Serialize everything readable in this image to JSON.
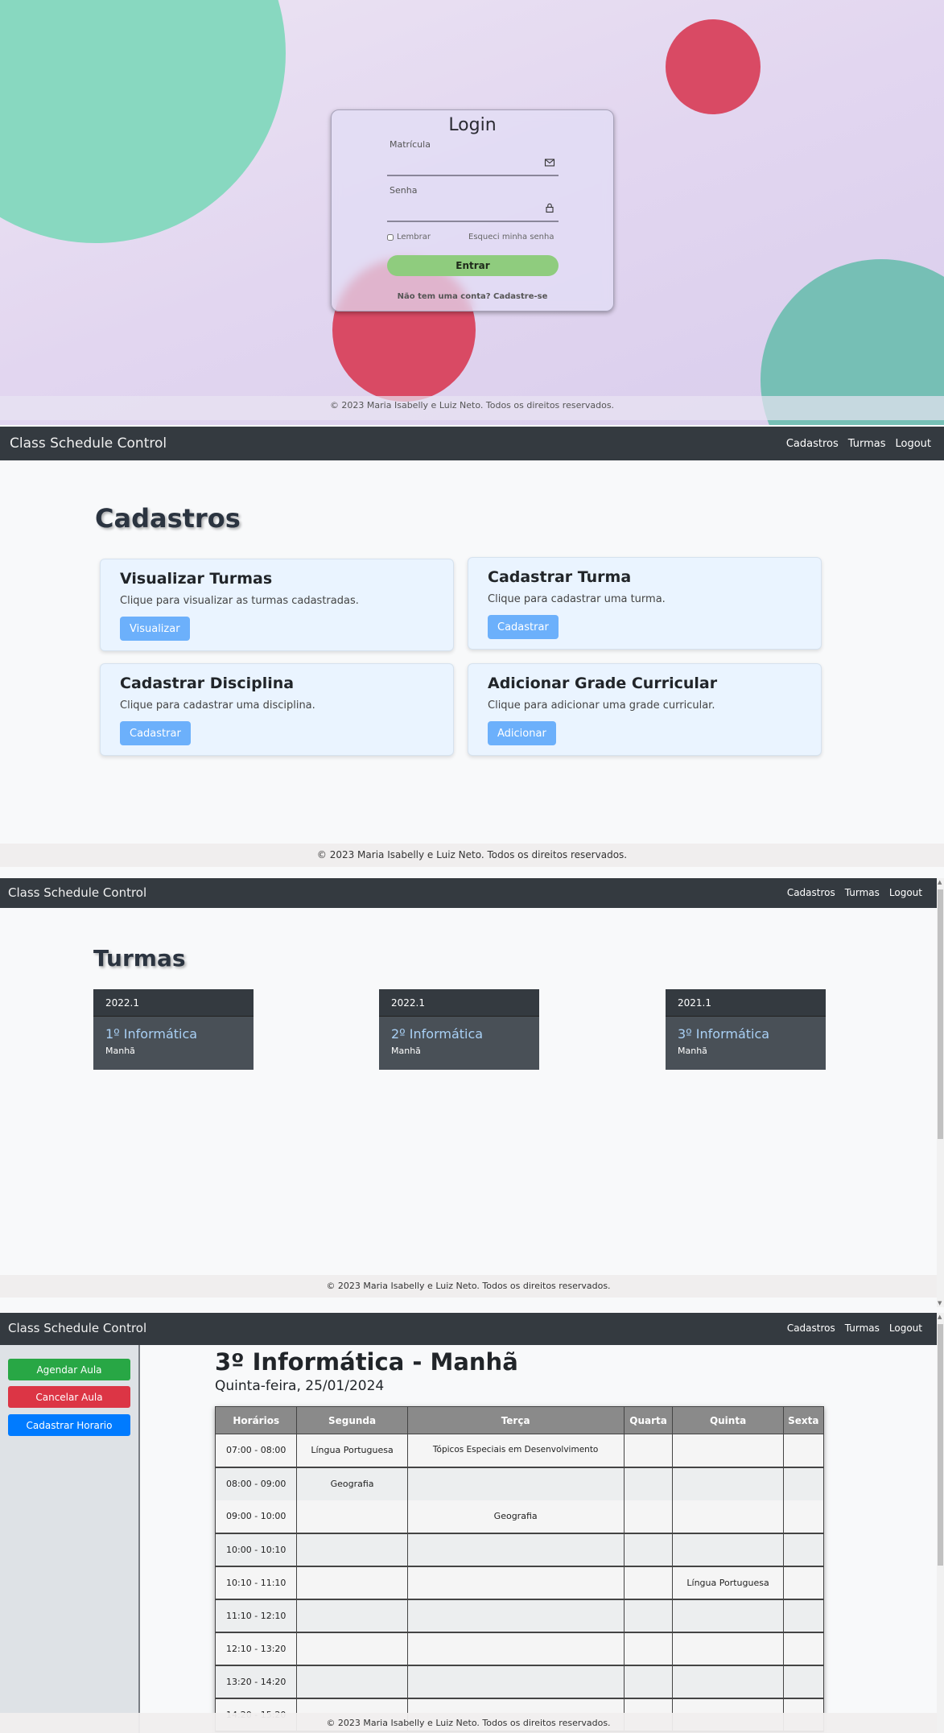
{
  "login": {
    "title": "Login",
    "matricula_label": "Matrícula",
    "senha_label": "Senha",
    "remember_label": "Lembrar",
    "forgot_label": "Esqueci minha senha",
    "submit_label": "Entrar",
    "signup_text": "Não tem uma conta? Cadastre-se",
    "footer": "© 2023 Maria Isabelly e Luiz Neto. Todos os direitos reservados.",
    "colors": {
      "bubble_teal": "#88d8c0",
      "bubble_red": "#d94a64",
      "button_green": "#8fcc7e"
    }
  },
  "navbar": {
    "brand": "Class Schedule Control",
    "links": [
      "Cadastros",
      "Turmas",
      "Logout"
    ],
    "color": "#343a40"
  },
  "cadastros": {
    "title": "Cadastros",
    "cards": [
      {
        "title": "Visualizar Turmas",
        "text": "Clique para visualizar as turmas cadastradas.",
        "button": "Visualizar"
      },
      {
        "title": "Cadastrar Turma",
        "text": "Clique para cadastrar uma turma.",
        "button": "Cadastrar"
      },
      {
        "title": "Cadastrar Disciplina",
        "text": "Clique para cadastrar uma disciplina.",
        "button": "Cadastrar"
      },
      {
        "title": "Adicionar Grade Curricular",
        "text": "Clique para adicionar uma grade curricular.",
        "button": "Adicionar"
      }
    ],
    "footer": "© 2023 Maria Isabelly e Luiz Neto. Todos os direitos reservados."
  },
  "turmas": {
    "title": "Turmas",
    "items": [
      {
        "period": "2022.1",
        "name": "1º Informática",
        "shift": "Manhã"
      },
      {
        "period": "2022.1",
        "name": "2º Informática",
        "shift": "Manhã"
      },
      {
        "period": "2021.1",
        "name": "3º Informática",
        "shift": "Manhã"
      }
    ],
    "footer": "© 2023 Maria Isabelly e Luiz Neto. Todos os direitos reservados."
  },
  "grade": {
    "sidebar": [
      {
        "label": "Agendar Aula",
        "color": "#28a745"
      },
      {
        "label": "Cancelar Aula",
        "color": "#dc3545"
      },
      {
        "label": "Cadastrar Horario",
        "color": "#007bff"
      }
    ],
    "title": "3º Informática - Manhã",
    "date": "Quinta-feira, 25/01/2024",
    "headers": [
      "Horários",
      "Segunda",
      "Terça",
      "Quarta",
      "Quinta",
      "Sexta"
    ],
    "rows": [
      [
        "07:00 - 08:00",
        "Língua Portuguesa",
        "Tópicos Especiais em Desenvolvimento",
        "",
        "",
        ""
      ],
      [
        "08:00 - 09:00",
        "Geografia",
        "",
        "",
        "",
        ""
      ],
      [
        "09:00 - 10:00",
        "",
        "Geografia",
        "",
        "",
        ""
      ],
      [
        "10:00 - 10:10",
        "",
        "",
        "",
        "",
        ""
      ],
      [
        "10:10 - 11:10",
        "",
        "",
        "",
        "Língua Portuguesa",
        ""
      ],
      [
        "11:10 - 12:10",
        "",
        "",
        "",
        "",
        ""
      ],
      [
        "12:10 - 13:20",
        "",
        "",
        "",
        "",
        ""
      ],
      [
        "13:20 - 14:20",
        "",
        "",
        "",
        "",
        ""
      ],
      [
        "14:20 - 15:20",
        "",
        "",
        "",
        "",
        ""
      ]
    ],
    "footer": "© 2023 Maria Isabelly e Luiz Neto. Todos os direitos reservados."
  }
}
